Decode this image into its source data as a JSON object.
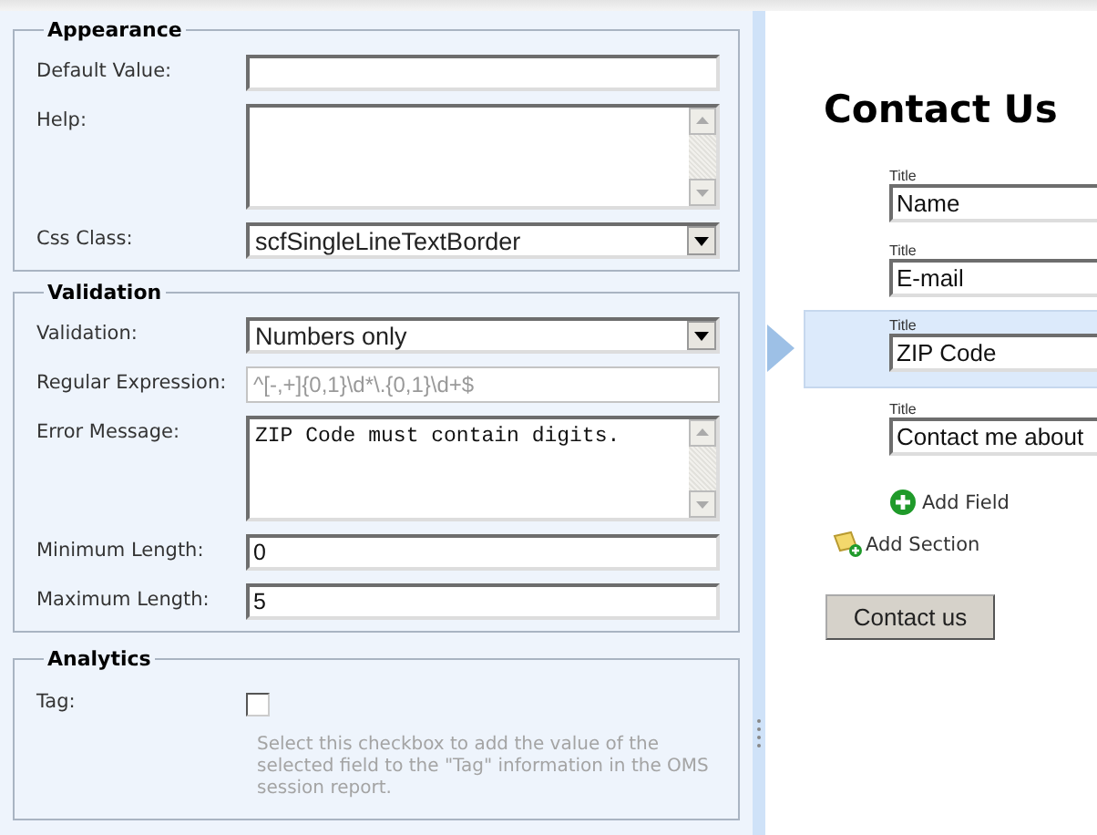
{
  "sections": [
    {
      "title": "Appearance",
      "fields": [
        {
          "kind": "text",
          "label": "Default Value:"
        },
        {
          "kind": "textarea",
          "label": "Help:"
        },
        {
          "kind": "select",
          "label": "Css Class:",
          "value": "scfSingleLineTextBorder"
        }
      ]
    },
    {
      "title": "Validation",
      "fields": [
        {
          "kind": "select",
          "label": "Validation:",
          "value": "Numbers only"
        },
        {
          "kind": "text",
          "label": "Regular Expression:",
          "value": "^[-,+]{0,1}\\d*\\.{0,1}\\d+$",
          "disabled": true
        },
        {
          "kind": "textarea",
          "label": "Error Message:",
          "value": "ZIP Code must contain digits."
        },
        {
          "kind": "text",
          "label": "Minimum Length:",
          "value": "0",
          "disabled": false
        },
        {
          "kind": "text",
          "label": "Maximum Length:",
          "value": "5",
          "disabled": false
        }
      ]
    },
    {
      "title": "Analytics",
      "fields": [
        {
          "kind": "checkbox",
          "label": "Tag:",
          "checked": false,
          "help": "Select this checkbox to add the value of the selected field to the \"Tag\" information in the OMS session report."
        }
      ]
    }
  ],
  "form": {
    "title": "Contact Us",
    "fields": [
      {
        "label": "Title",
        "value": "Name",
        "selected": false
      },
      {
        "label": "Title",
        "value": "E-mail",
        "selected": false
      },
      {
        "label": "Title",
        "value": "ZIP Code",
        "selected": true
      },
      {
        "label": "Title",
        "value": "Contact me about",
        "selected": false
      }
    ],
    "add_field": "Add Field",
    "add_section": "Add Section",
    "submit": "Contact us"
  }
}
